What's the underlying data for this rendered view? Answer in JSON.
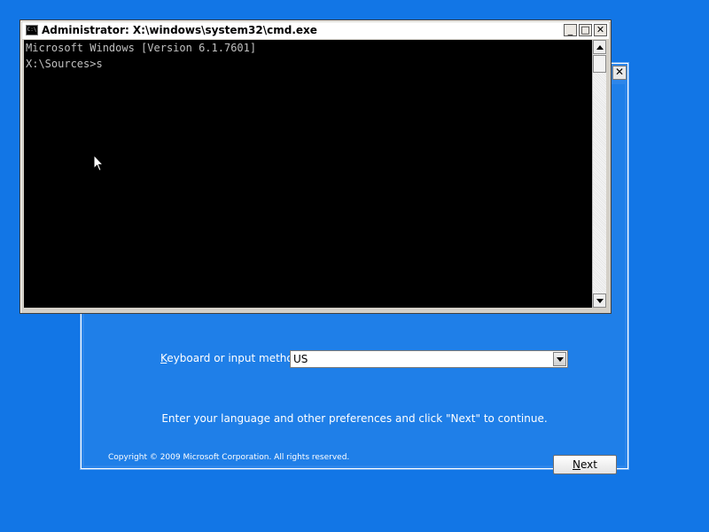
{
  "colors": {
    "desktop": "#1276e6",
    "console_bg": "#000000",
    "console_text": "#c0c0c0",
    "setup_text": "#ffffff"
  },
  "cmd": {
    "title": "Administrator: X:\\windows\\system32\\cmd.exe",
    "app_icon": "cmd-icon",
    "app_icon_text": "C:\\",
    "buttons": {
      "minimize": "_",
      "maximize": "□",
      "close": "✕"
    },
    "lines": [
      "Microsoft Windows [Version 6.1.7601]",
      "",
      "X:\\Sources>s"
    ]
  },
  "setup": {
    "close": "✕",
    "keyboard_label_accel": "K",
    "keyboard_label_rest": "eyboard or input method:",
    "keyboard_value": "US",
    "instruction": "Enter your language and other preferences and click \"Next\" to continue.",
    "copyright": "Copyright © 2009 Microsoft Corporation. All rights reserved.",
    "next_accel": "N",
    "next_rest": "ext"
  }
}
